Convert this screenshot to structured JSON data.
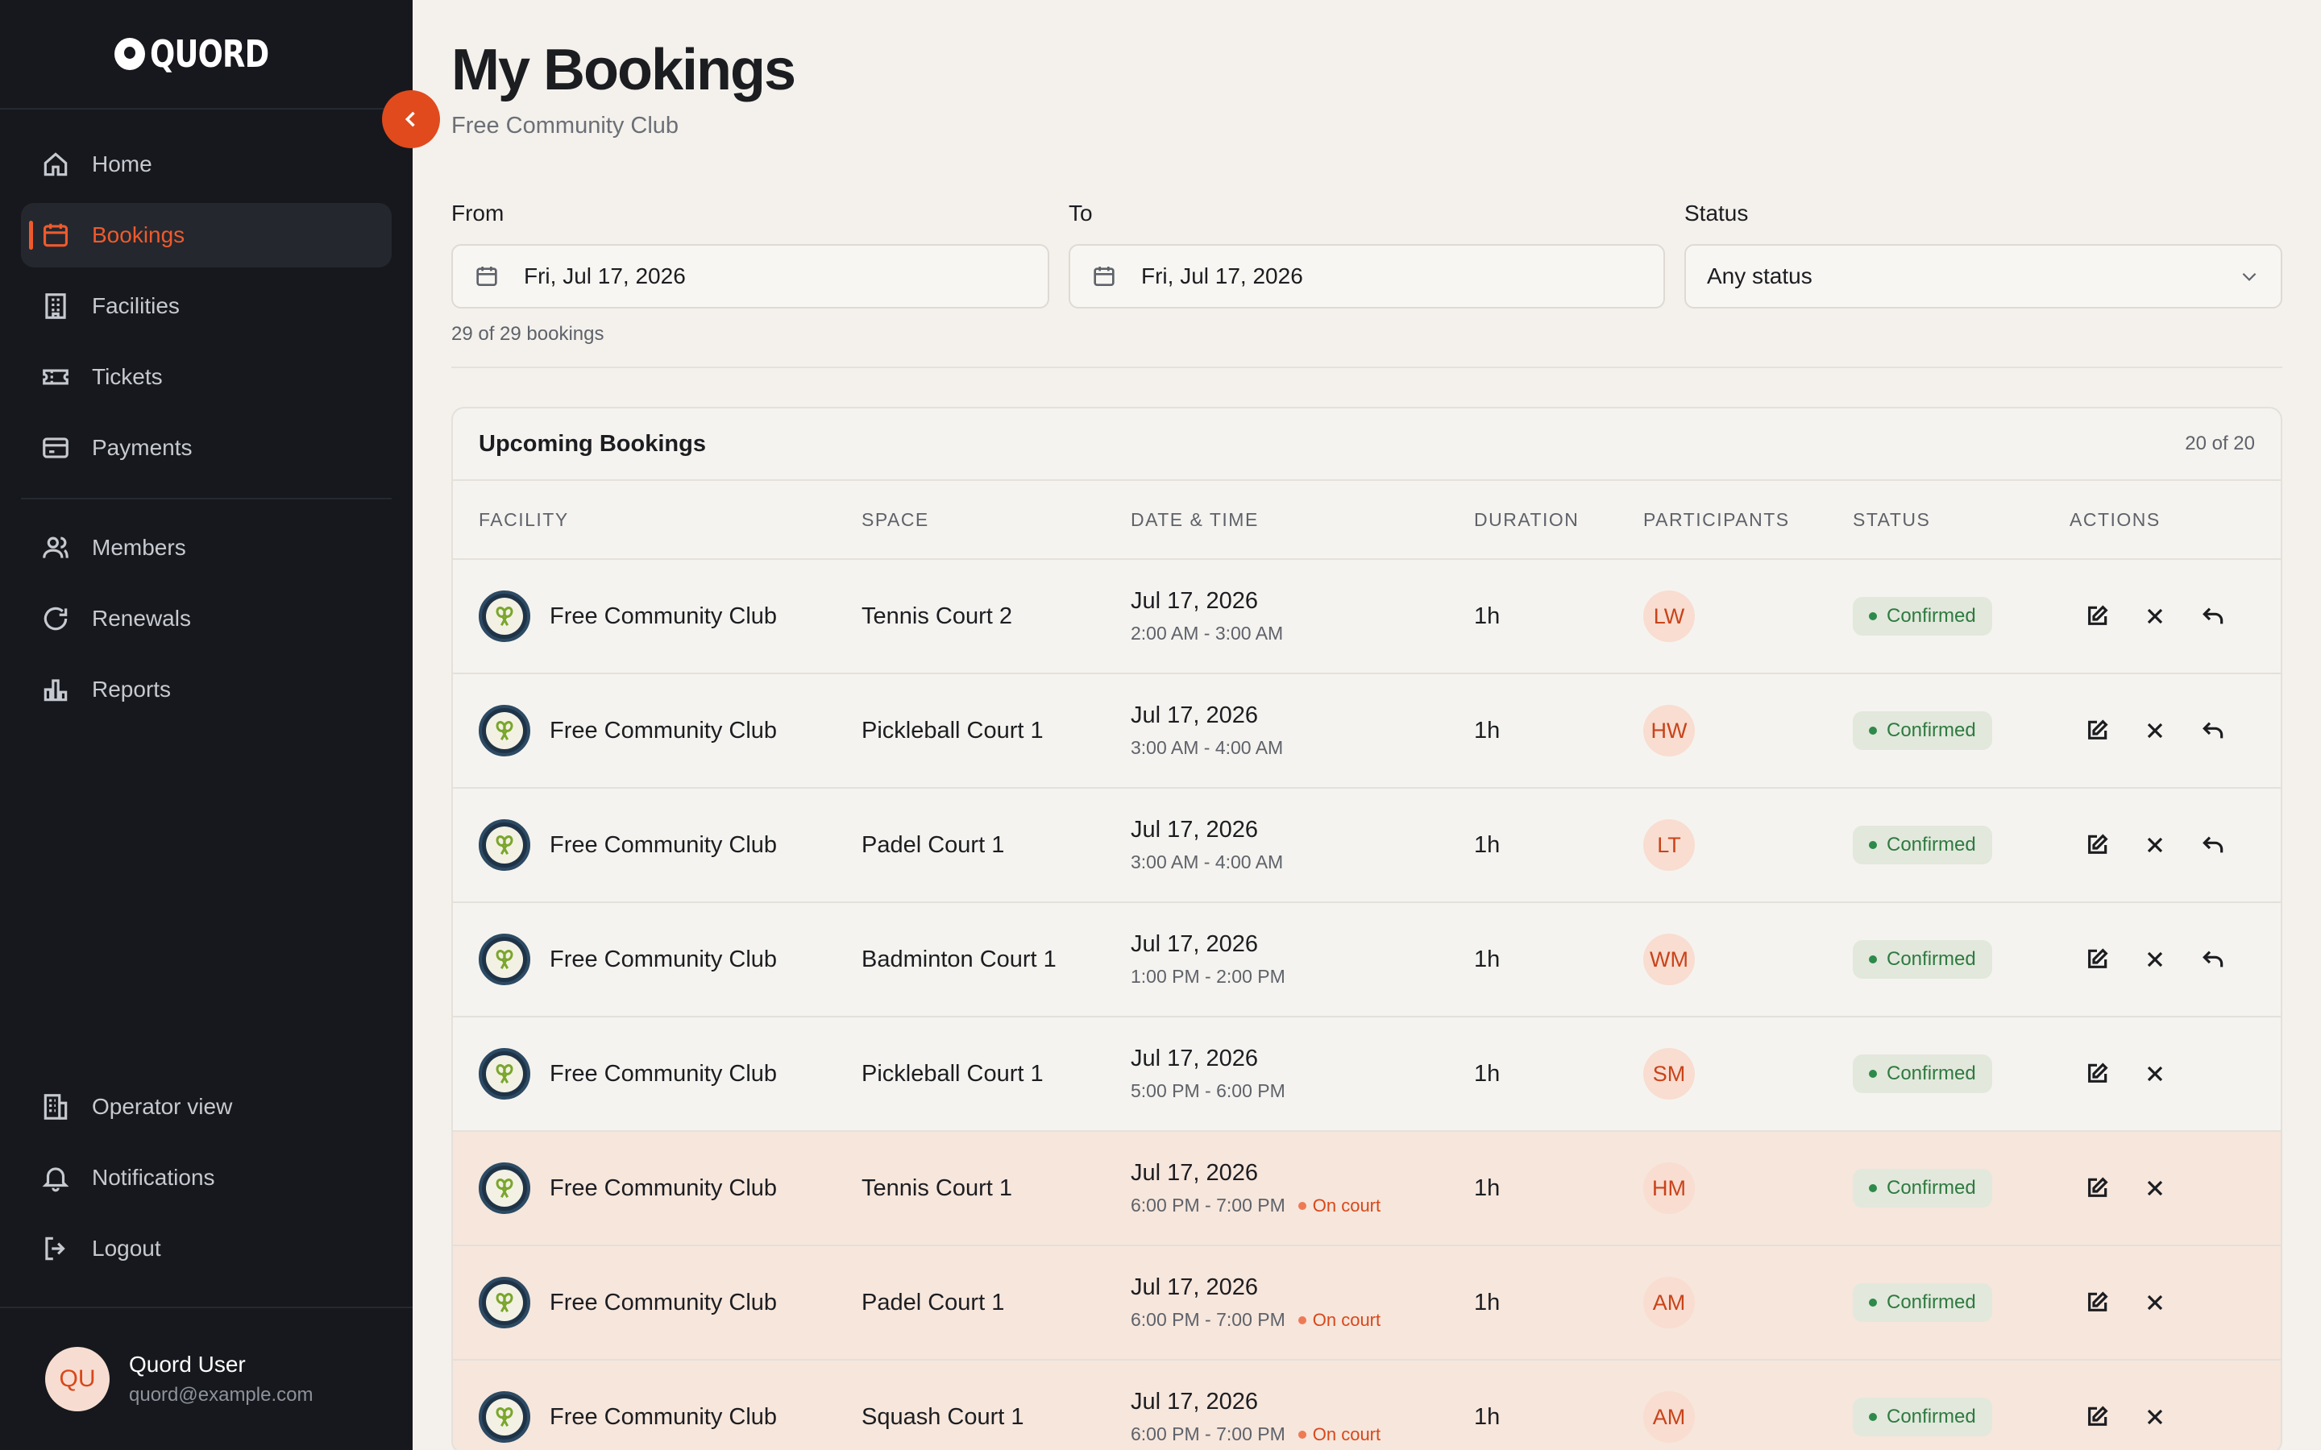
{
  "app": {
    "logo_text": "QUORD"
  },
  "sidebar": {
    "main_items": [
      {
        "label": "Home",
        "icon": "home-icon"
      },
      {
        "label": "Bookings",
        "icon": "calendar-icon",
        "active": true
      },
      {
        "label": "Facilities",
        "icon": "building-icon"
      },
      {
        "label": "Tickets",
        "icon": "ticket-icon"
      },
      {
        "label": "Payments",
        "icon": "credit-card-icon"
      }
    ],
    "secondary_items": [
      {
        "label": "Members",
        "icon": "users-icon"
      },
      {
        "label": "Renewals",
        "icon": "refresh-icon"
      },
      {
        "label": "Reports",
        "icon": "bar-chart-icon"
      }
    ],
    "bottom_items": [
      {
        "label": "Operator view",
        "icon": "operator-building-icon"
      },
      {
        "label": "Notifications",
        "icon": "bell-icon"
      },
      {
        "label": "Logout",
        "icon": "logout-icon"
      }
    ],
    "user": {
      "initials": "QU",
      "name": "Quord User",
      "email": "quord@example.com"
    },
    "accent_color": "#ee5a2c"
  },
  "header": {
    "title": "My Bookings",
    "subtitle": "Free Community Club"
  },
  "filters": {
    "from": {
      "label": "From",
      "value": "Fri, Jul 17, 2026"
    },
    "to": {
      "label": "To",
      "value": "Fri, Jul 17, 2026"
    },
    "status": {
      "label": "Status",
      "value": "Any status"
    }
  },
  "result_count": "29 of 29 bookings",
  "table": {
    "title": "Upcoming Bookings",
    "count": "20 of 20",
    "columns": [
      "FACILITY",
      "SPACE",
      "DATE & TIME",
      "DURATION",
      "PARTICIPANTS",
      "STATUS",
      "ACTIONS"
    ],
    "rows": [
      {
        "facility": "Free Community Club",
        "space": "Tennis Court 2",
        "date": "Jul 17, 2026",
        "time": "2:00 AM - 3:00 AM",
        "tag": "",
        "duration": "1h",
        "participant": "LW",
        "status": "Confirmed",
        "rebook": true,
        "on_court": false
      },
      {
        "facility": "Free Community Club",
        "space": "Pickleball Court 1",
        "date": "Jul 17, 2026",
        "time": "3:00 AM - 4:00 AM",
        "tag": "",
        "duration": "1h",
        "participant": "HW",
        "status": "Confirmed",
        "rebook": true,
        "on_court": false
      },
      {
        "facility": "Free Community Club",
        "space": "Padel Court 1",
        "date": "Jul 17, 2026",
        "time": "3:00 AM - 4:00 AM",
        "tag": "",
        "duration": "1h",
        "participant": "LT",
        "status": "Confirmed",
        "rebook": true,
        "on_court": false
      },
      {
        "facility": "Free Community Club",
        "space": "Badminton Court 1",
        "date": "Jul 17, 2026",
        "time": "1:00 PM - 2:00 PM",
        "tag": "",
        "duration": "1h",
        "participant": "WM",
        "status": "Confirmed",
        "rebook": true,
        "on_court": false
      },
      {
        "facility": "Free Community Club",
        "space": "Pickleball Court 1",
        "date": "Jul 17, 2026",
        "time": "5:00 PM - 6:00 PM",
        "tag": "",
        "duration": "1h",
        "participant": "SM",
        "status": "Confirmed",
        "rebook": false,
        "on_court": false
      },
      {
        "facility": "Free Community Club",
        "space": "Tennis Court 1",
        "date": "Jul 17, 2026",
        "time": "6:00 PM - 7:00 PM",
        "tag": "On court",
        "duration": "1h",
        "participant": "HM",
        "status": "Confirmed",
        "rebook": false,
        "on_court": true
      },
      {
        "facility": "Free Community Club",
        "space": "Padel Court 1",
        "date": "Jul 17, 2026",
        "time": "6:00 PM - 7:00 PM",
        "tag": "On court",
        "duration": "1h",
        "participant": "AM",
        "status": "Confirmed",
        "rebook": false,
        "on_court": true
      },
      {
        "facility": "Free Community Club",
        "space": "Squash Court 1",
        "date": "Jul 17, 2026",
        "time": "6:00 PM - 7:00 PM",
        "tag": "On court",
        "duration": "1h",
        "participant": "AM",
        "status": "Confirmed",
        "rebook": false,
        "on_court": true
      }
    ]
  }
}
